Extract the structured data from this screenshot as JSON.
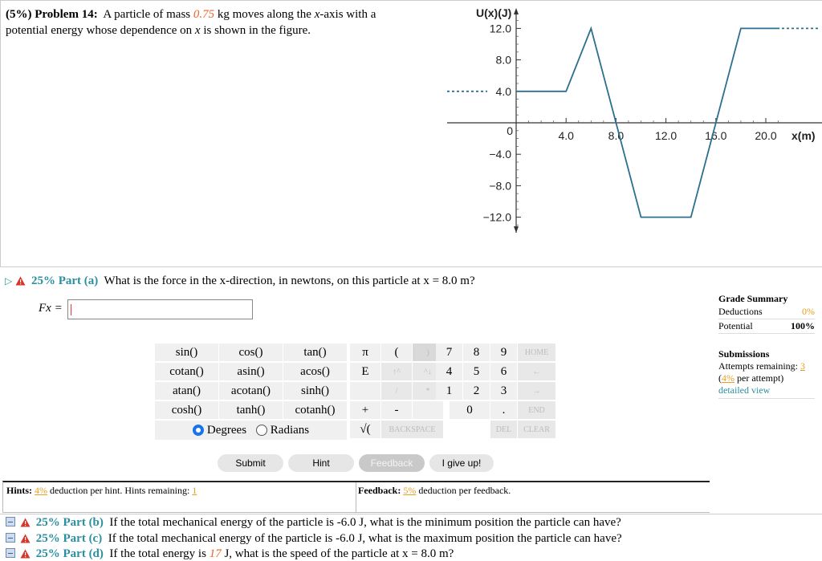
{
  "problem": {
    "weight": "(5%)",
    "label": "Problem 14:",
    "text_before_mass": "A particle of mass",
    "mass_value": "0.75",
    "text_after_mass_1": "kg moves along the",
    "axis_var": "x",
    "text_after_mass_2": "-axis with a",
    "line2_a": "potential energy whose dependence on",
    "line2_var": "x",
    "line2_b": "is shown in the figure."
  },
  "graph": {
    "y_label": "U(x)(J)",
    "x_label": "x(m)",
    "y_ticks": [
      "12.0",
      "8.0",
      "4.0",
      "0",
      "−4.0",
      "−8.0",
      "−12.0"
    ],
    "x_ticks": [
      "4.0",
      "8.0",
      "12.0",
      "16.0",
      "20.0"
    ],
    "curve_points": [
      [
        0,
        4
      ],
      [
        4,
        4
      ],
      [
        6,
        12
      ],
      [
        10,
        -12
      ],
      [
        14,
        -12
      ],
      [
        18,
        12
      ],
      [
        24,
        12
      ]
    ],
    "line_color": "#2d6f8e"
  },
  "part_a": {
    "weight": "25%",
    "label": "Part (a)",
    "question": "What is the force in the x-direction, in newtons, on this particle at x = 8.0 m?",
    "answer_label": "Fx =",
    "answer_value": ""
  },
  "calculator": {
    "func_keys": [
      [
        "sin()",
        "cos()",
        "tan()"
      ],
      [
        "cotan()",
        "asin()",
        "acos()"
      ],
      [
        "atan()",
        "acotan()",
        "sinh()"
      ],
      [
        "cosh()",
        "tanh()",
        "cotanh()"
      ]
    ],
    "sym_keys": [
      [
        "π",
        "(",
        ")"
      ],
      [
        "E",
        "↑^",
        "^↓"
      ],
      [
        "",
        "/",
        "*"
      ],
      [
        "+",
        "-",
        ""
      ],
      [
        "√(",
        "BACKSPACE",
        ""
      ]
    ],
    "num_keys": [
      [
        "7",
        "8",
        "9",
        "HOME"
      ],
      [
        "4",
        "5",
        "6",
        "←"
      ],
      [
        "1",
        "2",
        "3",
        "→"
      ],
      [
        "",
        "0",
        ".",
        "END"
      ],
      [
        "",
        "",
        "DEL",
        "CLEAR"
      ]
    ],
    "degrees_label": "Degrees",
    "radians_label": "Radians",
    "angle_mode": "Degrees"
  },
  "buttons": {
    "submit": "Submit",
    "hint": "Hint",
    "feedback": "Feedback",
    "give_up": "I give up!"
  },
  "hints": {
    "label": "Hints:",
    "pct": "4%",
    "text": "deduction per hint. Hints remaining:",
    "remaining": "1"
  },
  "feedback": {
    "label": "Feedback:",
    "pct": "5%",
    "text": "deduction per feedback."
  },
  "grade_summary": {
    "title": "Grade Summary",
    "deductions_label": "Deductions",
    "deductions_value": "0%",
    "potential_label": "Potential",
    "potential_value": "100%",
    "submissions_title": "Submissions",
    "attempts_label": "Attempts remaining:",
    "attempts_value": "3",
    "per_attempt_pct": "4%",
    "per_attempt_text": "per attempt)",
    "detailed_view": "detailed view"
  },
  "other_parts": [
    {
      "weight": "25%",
      "label": "Part (b)",
      "question": "If the total mechanical energy of the particle is -6.0 J, what is the minimum position the particle can have?"
    },
    {
      "weight": "25%",
      "label": "Part (c)",
      "question": "If the total mechanical energy of the particle is -6.0 J, what is the maximum position the particle can have?"
    },
    {
      "weight": "25%",
      "label": "Part (d)",
      "question_a": "If the total energy is",
      "energy_value": "17",
      "question_b": "J, what is the speed of the particle at x = 8.0 m?"
    }
  ],
  "colors": {
    "accent_teal": "#2a8fa0",
    "warn_red": "#d9362b",
    "orange": "#e8662f"
  }
}
